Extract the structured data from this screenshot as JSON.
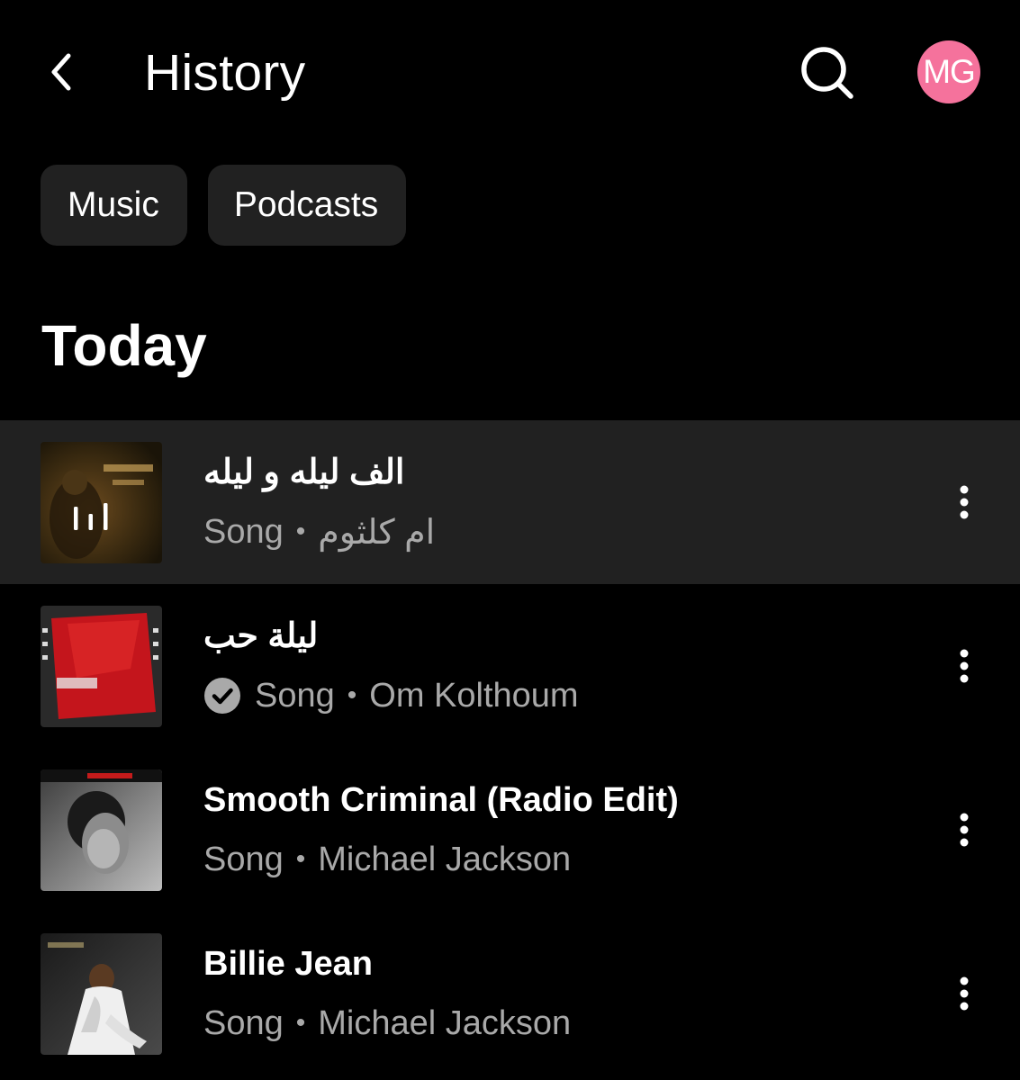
{
  "header": {
    "title": "History",
    "avatar_initials": "MG",
    "avatar_color": "#f5729c",
    "back_icon": "chevron-left-icon",
    "search_icon": "search-icon"
  },
  "filters": [
    {
      "label": "Music"
    },
    {
      "label": "Podcasts"
    }
  ],
  "section": {
    "title": "Today"
  },
  "items": [
    {
      "title": "الف ليله و ليله",
      "type": "Song",
      "artist": "ام كلثوم",
      "now_playing": true,
      "downloaded": false
    },
    {
      "title": "ليلة حب",
      "type": "Song",
      "artist": "Om Kolthoum",
      "now_playing": false,
      "downloaded": true
    },
    {
      "title": "Smooth Criminal (Radio Edit)",
      "type": "Song",
      "artist": "Michael Jackson",
      "now_playing": false,
      "downloaded": false
    },
    {
      "title": "Billie Jean",
      "type": "Song",
      "artist": "Michael Jackson",
      "now_playing": false,
      "downloaded": false
    }
  ],
  "separator": "•",
  "colors": {
    "background": "#000000",
    "chip_bg": "#212121",
    "active_row_bg": "#212121",
    "secondary_text": "#a9a9a9"
  }
}
